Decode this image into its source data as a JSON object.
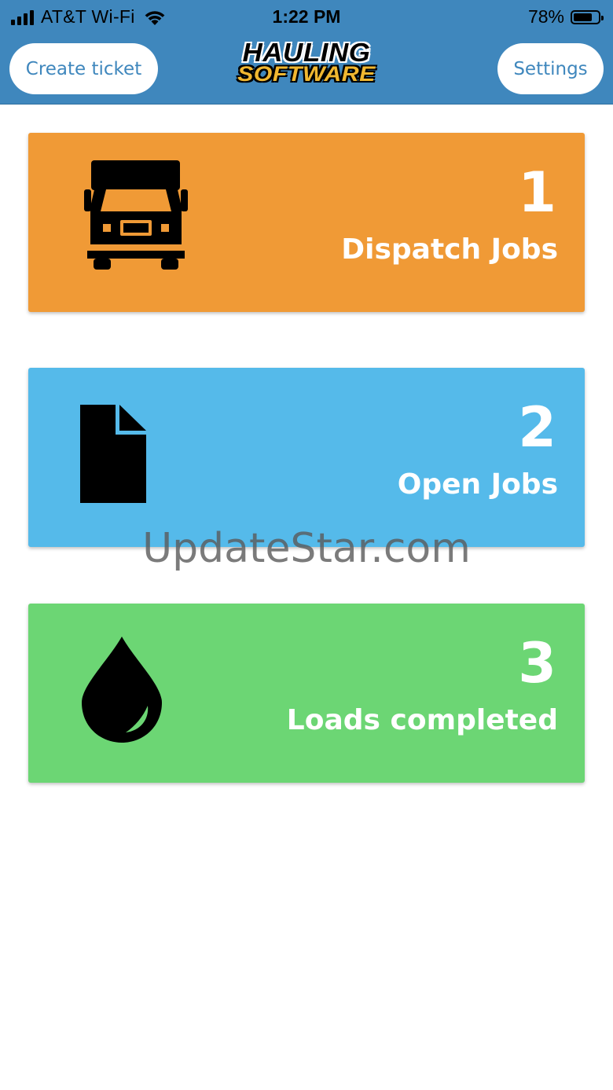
{
  "status_bar": {
    "carrier": "AT&T Wi-Fi",
    "time": "1:22 PM",
    "battery": "78%",
    "battery_level": 0.78,
    "icons": [
      "signal-icon",
      "wifi-icon",
      "battery-icon"
    ]
  },
  "header": {
    "create_ticket_label": "Create ticket",
    "settings_label": "Settings",
    "logo_top": "HAULING",
    "logo_bottom": "SOFTWARE"
  },
  "cards": [
    {
      "count": "1",
      "label": "Dispatch Jobs",
      "icon": "truck-icon",
      "color": "#f09a36"
    },
    {
      "count": "2",
      "label": "Open Jobs",
      "icon": "document-icon",
      "color": "#55baea"
    },
    {
      "count": "3",
      "label": "Loads completed",
      "icon": "drop-icon",
      "color": "#6cd674"
    }
  ],
  "watermark": "UpdateStar.com",
  "colors": {
    "header": "#3f87bd",
    "button_text": "#3f87bd",
    "logo_accent": "#f0b730"
  }
}
